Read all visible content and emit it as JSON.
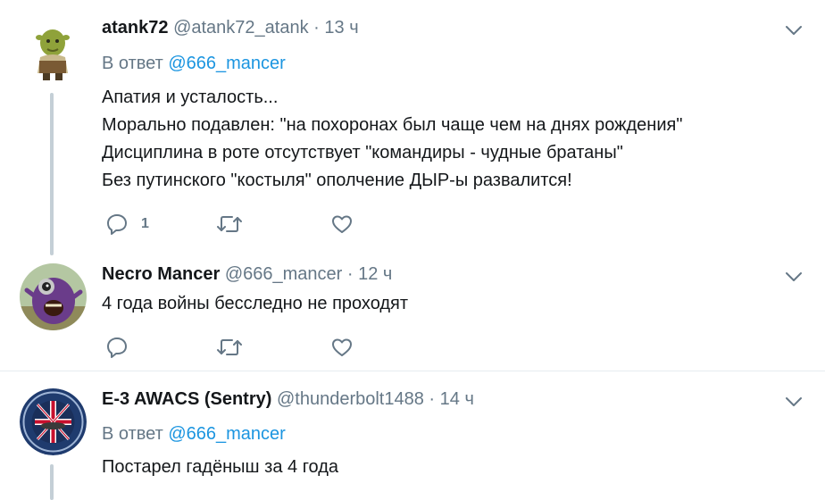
{
  "tweets": [
    {
      "name": "atank72",
      "handle": "@atank72_atank",
      "time": "13 ч",
      "reply_prefix": "В ответ",
      "reply_to": "@666_mancer",
      "lines": [
        "Апатия и усталость...",
        "Морально подавлен: \"на похоронах был чаще чем на днях рождения\"",
        "Дисциплина в роте отсутствует \"командиры - чудные братаны\"",
        "Без путинского \"костыля\" ополчение ДЫР-ы развалится!"
      ],
      "reply_count": "1"
    },
    {
      "name": "Necro Mancer",
      "handle": "@666_mancer",
      "time": "12 ч",
      "lines": [
        "4 года войны бесследно не проходят"
      ]
    },
    {
      "name": "E-3 AWACS (Sentry)",
      "handle": "@thunderbolt1488",
      "time": "14 ч",
      "reply_prefix": "В ответ",
      "reply_to": "@666_mancer",
      "lines": [
        "Постарел гадёныш за 4 года"
      ]
    }
  ],
  "dot": "·",
  "icons": {
    "reply": "reply-icon",
    "retweet": "retweet-icon",
    "like": "heart-icon",
    "menu": "chevron-down-icon"
  },
  "colors": {
    "text": "#14171a",
    "muted": "#657786",
    "link": "#1b95e0",
    "icon": "#657786",
    "thread_line": "#c4cfd6",
    "divider": "#e6ecf0"
  }
}
